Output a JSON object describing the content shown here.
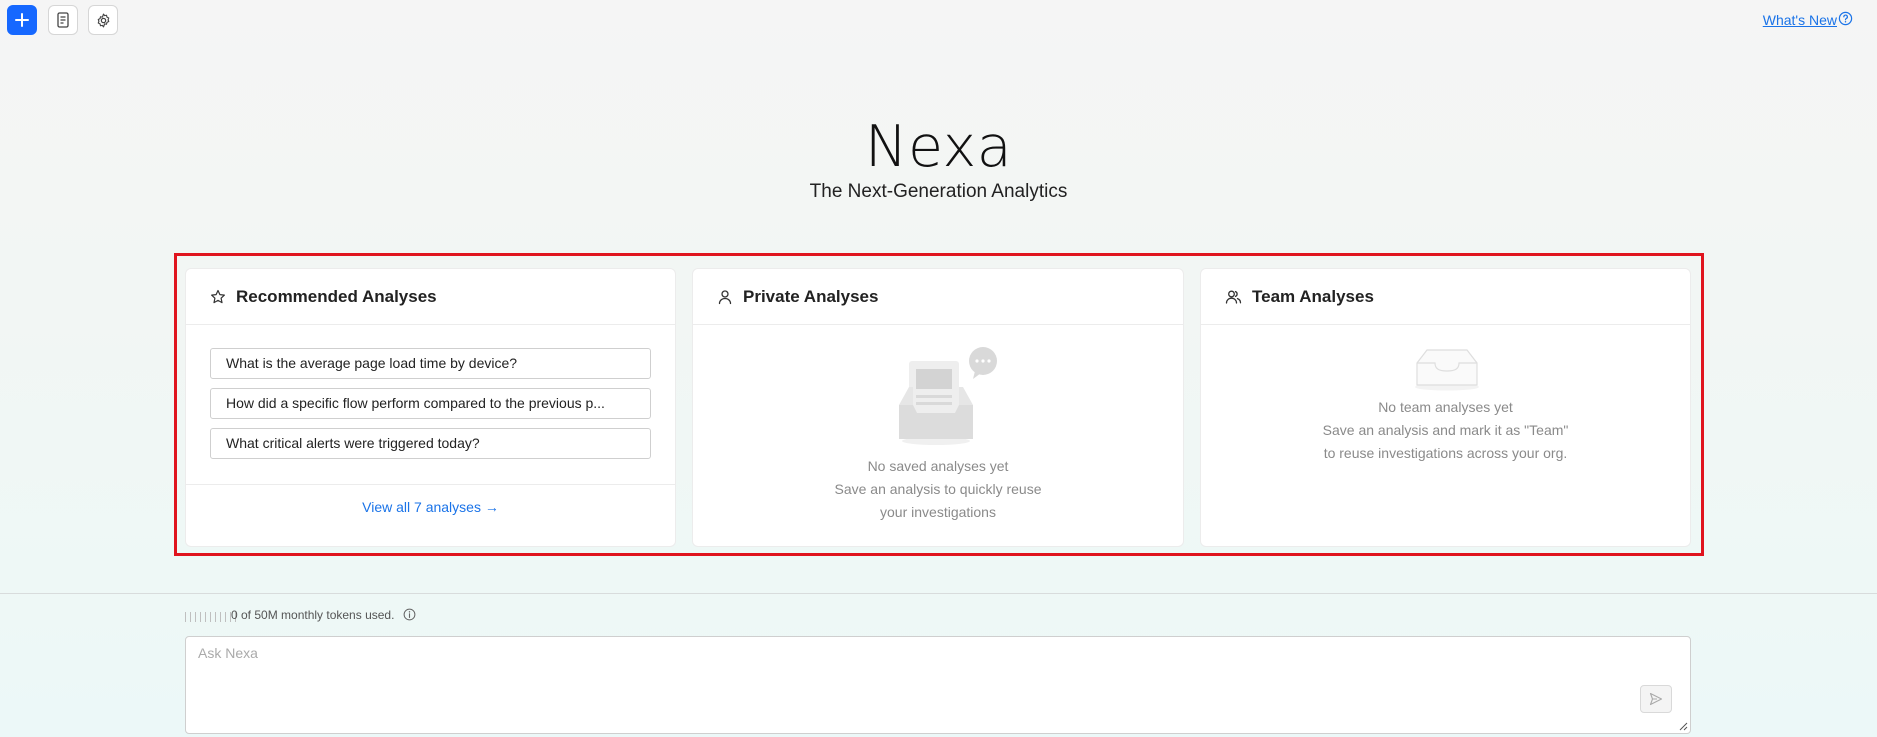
{
  "toolbar": {
    "new_icon": "plus-icon",
    "history_icon": "document-icon",
    "settings_icon": "gear-icon",
    "whats_new_label": "What's New",
    "help_icon": "question-circle-icon",
    "accent": "#1668ff"
  },
  "hero": {
    "title": "Nexa",
    "subtitle": "The Next-Generation Analytics"
  },
  "cards": {
    "recommended": {
      "icon": "star-icon",
      "title": "Recommended Analyses",
      "questions": [
        "What is the average page load time by device?",
        "How did a specific flow perform compared to the previous p...",
        "What critical alerts were triggered today?"
      ],
      "view_all": "View all 7 analyses →"
    },
    "private": {
      "icon": "user-icon",
      "title": "Private Analyses",
      "empty_title": "No saved analyses yet",
      "empty_line1": "Save an analysis to quickly reuse",
      "empty_line2": "your investigations"
    },
    "team": {
      "icon": "team-icon",
      "title": "Team Analyses",
      "empty_title": "No team analyses yet",
      "empty_line1": "Save an analysis and mark it as \"Team\"",
      "empty_line2": "to reuse investigations across your org."
    }
  },
  "usage": {
    "text": "0 of 50M monthly tokens used.",
    "info_icon": "info-icon"
  },
  "ask": {
    "placeholder": "Ask Nexa",
    "send_icon": "send-icon"
  }
}
